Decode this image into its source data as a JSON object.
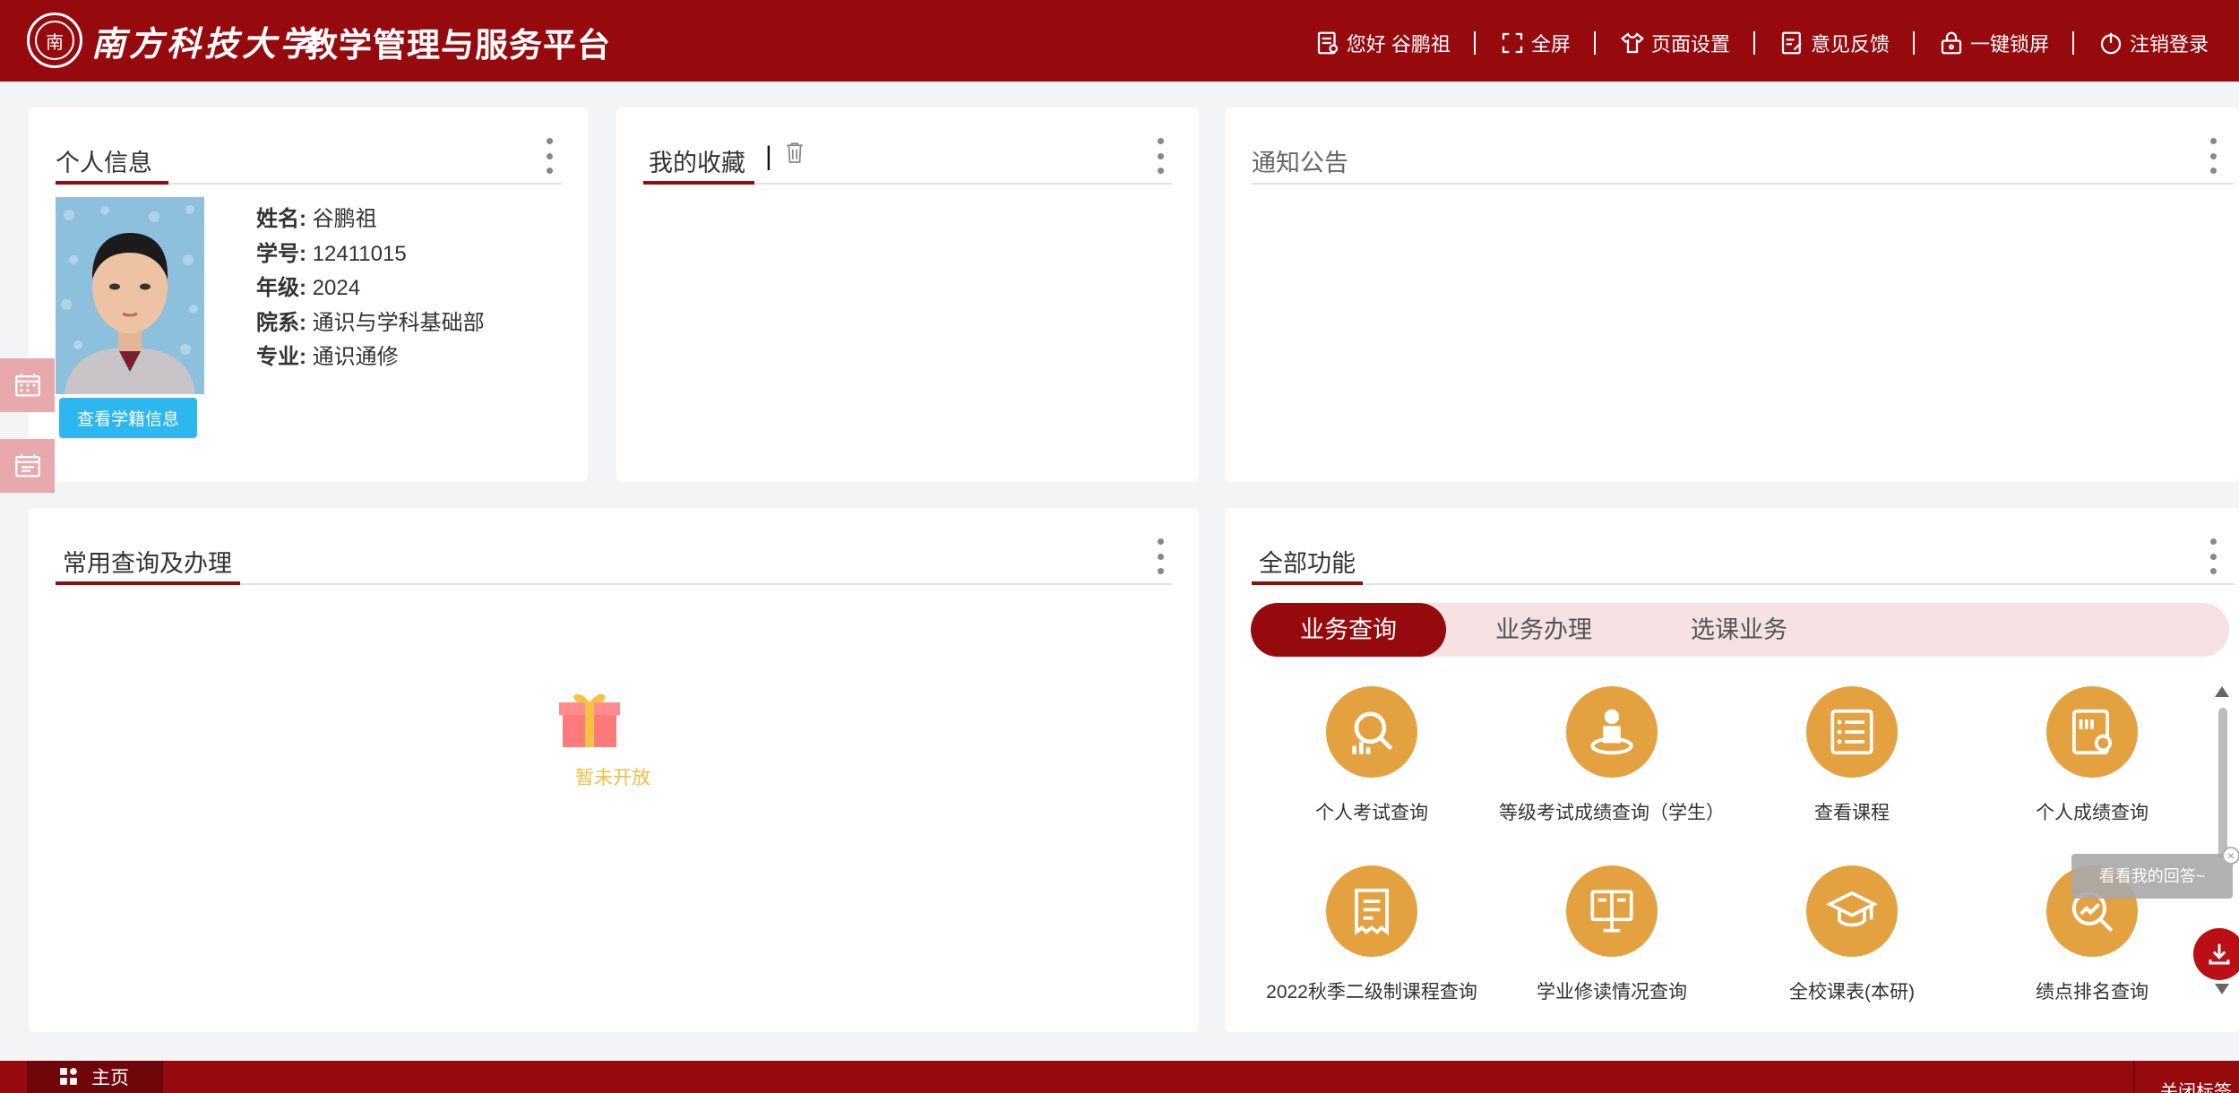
{
  "header": {
    "uni_name": "南方科技大学",
    "platform_name": "教学管理与服务平台",
    "nav": [
      {
        "label": "您好 谷鹏祖",
        "icon": "user-doc-icon"
      },
      {
        "label": "全屏",
        "icon": "fullscreen-icon"
      },
      {
        "label": "页面设置",
        "icon": "shirt-icon"
      },
      {
        "label": "意见反馈",
        "icon": "feedback-icon"
      },
      {
        "label": "一键锁屏",
        "icon": "lock-icon"
      },
      {
        "label": "注销登录",
        "icon": "power-icon"
      }
    ]
  },
  "personal": {
    "title": "个人信息",
    "fields": [
      {
        "label": "姓名:",
        "value": "谷鹏祖"
      },
      {
        "label": "学号:",
        "value": "12411015"
      },
      {
        "label": "年级:",
        "value": "2024"
      },
      {
        "label": "院系:",
        "value": "通识与学科基础部"
      },
      {
        "label": "专业:",
        "value": "通识通修"
      }
    ],
    "button": "查看学籍信息"
  },
  "favorites": {
    "title": "我的收藏",
    "separator": "|"
  },
  "notice": {
    "title": "通知公告"
  },
  "common": {
    "title": "常用查询及办理",
    "empty_text": "暂未开放"
  },
  "all_functions": {
    "title": "全部功能",
    "tabs": [
      "业务查询",
      "业务办理",
      "选课业务"
    ],
    "active_tab": 0,
    "items": [
      {
        "label": "个人考试查询",
        "icon": "search-chart-icon"
      },
      {
        "label": "等级考试成绩查询（学生）",
        "icon": "person-podium-icon"
      },
      {
        "label": "查看课程",
        "icon": "course-list-icon"
      },
      {
        "label": "个人成绩查询",
        "icon": "grade-book-icon"
      },
      {
        "label": "2022秋季二级制课程查询",
        "icon": "receipt-icon"
      },
      {
        "label": "学业修读情况查询",
        "icon": "open-book-icon"
      },
      {
        "label": "全校课表(本研)",
        "icon": "graduation-cap-icon"
      },
      {
        "label": "绩点排名查询",
        "icon": "trend-search-icon"
      }
    ]
  },
  "tooltip": {
    "text": "看看我的回答~",
    "close": "×"
  },
  "bottom": {
    "home_tab": "主页",
    "close_tabs": "关闭标签"
  },
  "colors": {
    "brand": "#960a0e",
    "icon_bg": "#e4a13f",
    "button_blue": "#2cb7ee",
    "empty_text": "#f3bd43"
  }
}
